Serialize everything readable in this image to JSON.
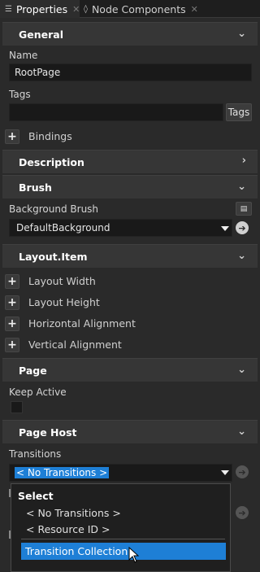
{
  "tabs": [
    {
      "label": "Properties",
      "icon": "list-icon"
    },
    {
      "label": "Node Components",
      "icon": "components-icon"
    }
  ],
  "sections": {
    "general": "General",
    "description": "Description",
    "brush": "Brush",
    "layout_item": "Layout.Item",
    "page": "Page",
    "page_host": "Page Host"
  },
  "general": {
    "name_label": "Name",
    "name_value": "RootPage",
    "tags_label": "Tags",
    "tags_value": "",
    "tags_button": "Tags",
    "bindings_label": "Bindings"
  },
  "brush": {
    "background_label": "Background Brush",
    "background_value": "DefaultBackground"
  },
  "layout_item": {
    "properties": [
      "Layout Width",
      "Layout Height",
      "Horizontal Alignment",
      "Vertical Alignment"
    ]
  },
  "page": {
    "keep_active_label": "Keep Active",
    "keep_active_checked": false
  },
  "page_host": {
    "transitions_label": "Transitions",
    "transitions_value": "< No Transitions >"
  },
  "dropdown": {
    "header": "Select",
    "options": [
      "< No Transitions >",
      "< Resource ID >"
    ],
    "highlighted": "Transition Collection"
  },
  "colors": {
    "selection": "#1e7fd6",
    "field_bg": "#191919",
    "section_bg": "#363636"
  }
}
